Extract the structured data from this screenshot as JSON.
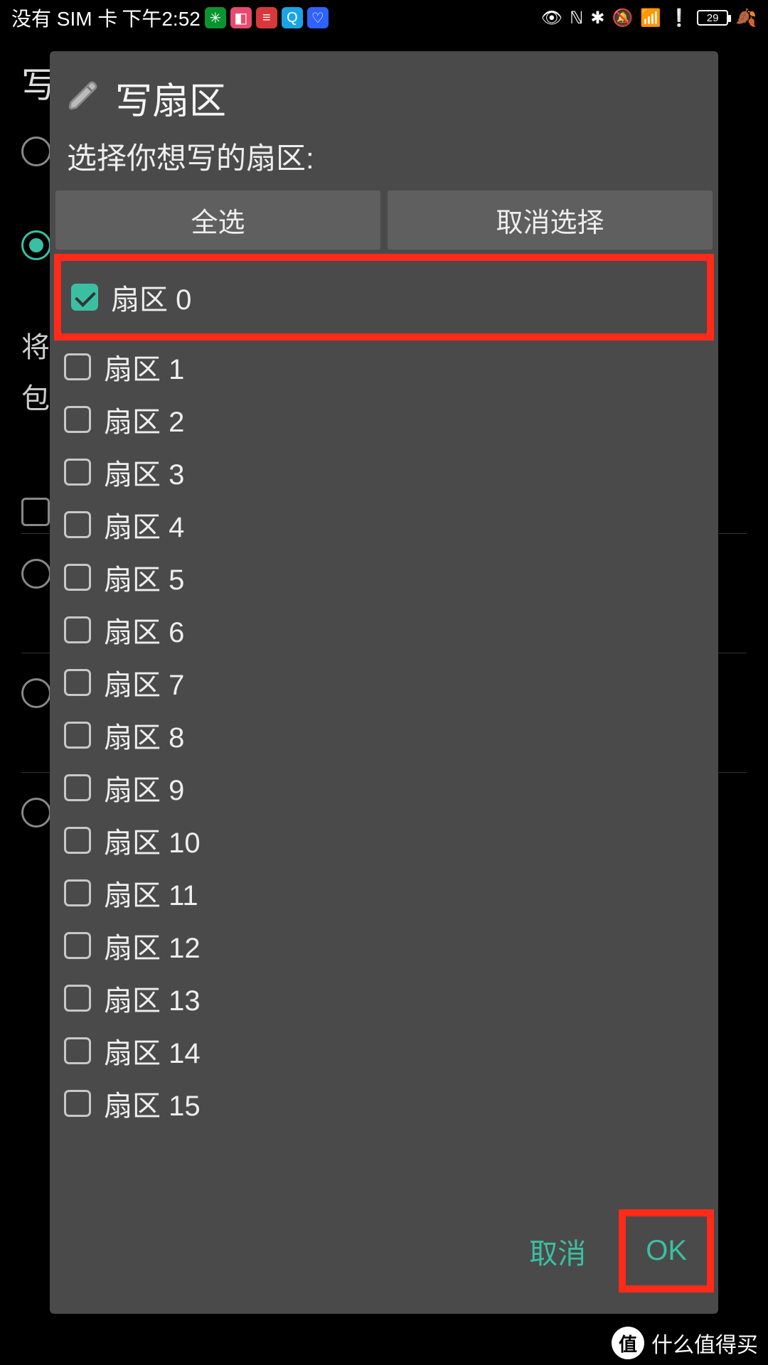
{
  "status": {
    "sim_text": "没有 SIM 卡",
    "time": "下午2:52",
    "battery_percent": "29"
  },
  "bg": {
    "title": "写",
    "text1": "将",
    "text2": "包"
  },
  "dialog": {
    "title": "写扇区",
    "subtitle": "选择你想写的扇区:",
    "select_all": "全选",
    "deselect_all": "取消选择",
    "sectors": [
      {
        "label": "扇区 0",
        "checked": true
      },
      {
        "label": "扇区 1",
        "checked": false
      },
      {
        "label": "扇区 2",
        "checked": false
      },
      {
        "label": "扇区 3",
        "checked": false
      },
      {
        "label": "扇区 4",
        "checked": false
      },
      {
        "label": "扇区 5",
        "checked": false
      },
      {
        "label": "扇区 6",
        "checked": false
      },
      {
        "label": "扇区 7",
        "checked": false
      },
      {
        "label": "扇区 8",
        "checked": false
      },
      {
        "label": "扇区 9",
        "checked": false
      },
      {
        "label": "扇区 10",
        "checked": false
      },
      {
        "label": "扇区 11",
        "checked": false
      },
      {
        "label": "扇区 12",
        "checked": false
      },
      {
        "label": "扇区 13",
        "checked": false
      },
      {
        "label": "扇区 14",
        "checked": false
      },
      {
        "label": "扇区 15",
        "checked": false
      }
    ],
    "cancel": "取消",
    "ok": "OK"
  },
  "watermark": {
    "badge": "值",
    "text": "什么值得买"
  }
}
